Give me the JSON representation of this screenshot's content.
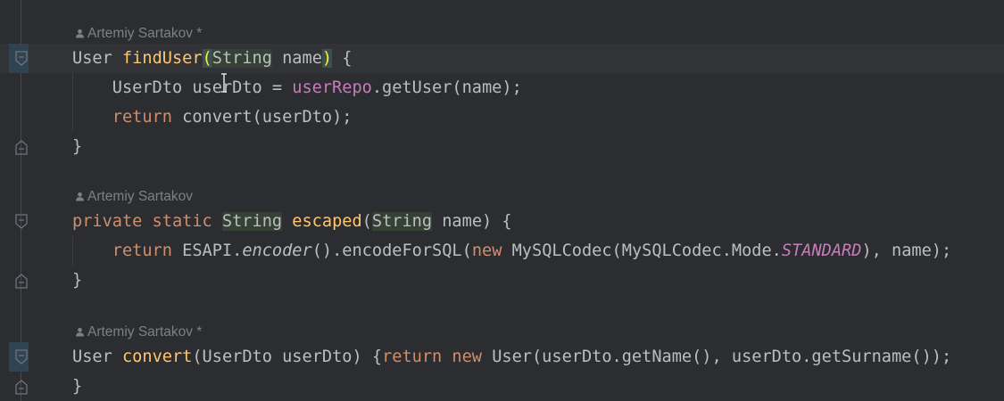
{
  "blocks": [
    {
      "author": "Artemiy Sartakov *",
      "lines": [
        [
          [
            "User ",
            ""
          ],
          [
            "findUser",
            "fn"
          ],
          [
            "(",
            "brace"
          ],
          [
            "|",
            "caret"
          ],
          [
            "String",
            "hl"
          ],
          [
            " name",
            ""
          ],
          [
            ")",
            "brace"
          ],
          [
            " {",
            ""
          ]
        ],
        [
          [
            "    UserDto userDto = ",
            ""
          ],
          [
            "userRepo",
            "fld"
          ],
          [
            ".getUser(name);",
            ""
          ]
        ],
        [
          [
            "    ",
            ""
          ],
          [
            "return",
            "kw"
          ],
          [
            " convert(userDto);",
            ""
          ]
        ],
        [
          [
            "}",
            ""
          ]
        ]
      ]
    },
    {
      "author": "Artemiy Sartakov",
      "lines": [
        [
          [
            "private static ",
            "kw"
          ],
          [
            "String",
            "hl"
          ],
          [
            " ",
            ""
          ],
          [
            "escaped",
            "fn"
          ],
          [
            "(",
            ""
          ],
          [
            "String",
            "hl"
          ],
          [
            " name) {",
            ""
          ]
        ],
        [
          [
            "    ",
            ""
          ],
          [
            "return",
            "kw"
          ],
          [
            " ESAPI.",
            ""
          ],
          [
            "encoder",
            "it"
          ],
          [
            "().encodeForSQL(",
            ""
          ],
          [
            "new",
            "kw"
          ],
          [
            " MySQLCodec(MySQLCodec.Mode.",
            ""
          ],
          [
            "STANDARD",
            "itf"
          ],
          [
            "), name);",
            ""
          ]
        ],
        [
          [
            "}",
            ""
          ]
        ]
      ]
    },
    {
      "author": "Artemiy Sartakov *",
      "lines": [
        [
          [
            "User ",
            ""
          ],
          [
            "convert",
            "fn"
          ],
          [
            "(UserDto userDto) {",
            ""
          ],
          [
            "return new",
            "kw"
          ],
          [
            " User(userDto.getName(), userDto.getSurname());",
            ""
          ]
        ],
        [
          [
            "}",
            ""
          ]
        ]
      ]
    }
  ]
}
